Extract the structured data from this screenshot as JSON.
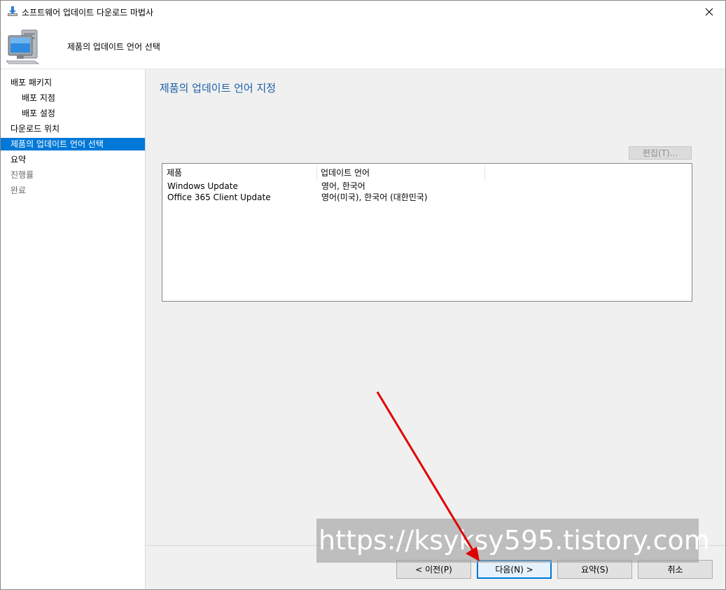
{
  "window": {
    "title": "소프트웨어 업데이트 다운로드 마법사",
    "header_title": "제품의 업데이트 언어 선택"
  },
  "nav": {
    "items": [
      {
        "label": "배포 패키지",
        "state": "normal"
      },
      {
        "label": "배포 지점",
        "state": "normal"
      },
      {
        "label": "배포 설정",
        "state": "normal"
      },
      {
        "label": "다운로드 위치",
        "state": "normal"
      },
      {
        "label": "제품의 업데이트 언어 선택",
        "state": "active"
      },
      {
        "label": "요약",
        "state": "normal"
      },
      {
        "label": "진행률",
        "state": "disabled"
      },
      {
        "label": "완료",
        "state": "disabled"
      }
    ]
  },
  "main": {
    "page_title": "제품의 업데이트 언어 지정",
    "edit_label": "편집(T)...",
    "table": {
      "columns": [
        "제품",
        "업데이트 언어"
      ],
      "rows": [
        [
          "Windows Update",
          "영어, 한국어"
        ],
        [
          "Office 365 Client Update",
          "영어(미국), 한국어 (대한민국)"
        ]
      ]
    }
  },
  "buttons": {
    "prev": "< 이전(P)",
    "next": "다음(N) >",
    "summary": "요약(S)",
    "cancel": "취소"
  },
  "watermark": "https://ksyksy595.tistory.com",
  "colors": {
    "accent": "#0078d7",
    "page_title": "#1e5fa8",
    "annotation_arrow": "#e00000"
  }
}
